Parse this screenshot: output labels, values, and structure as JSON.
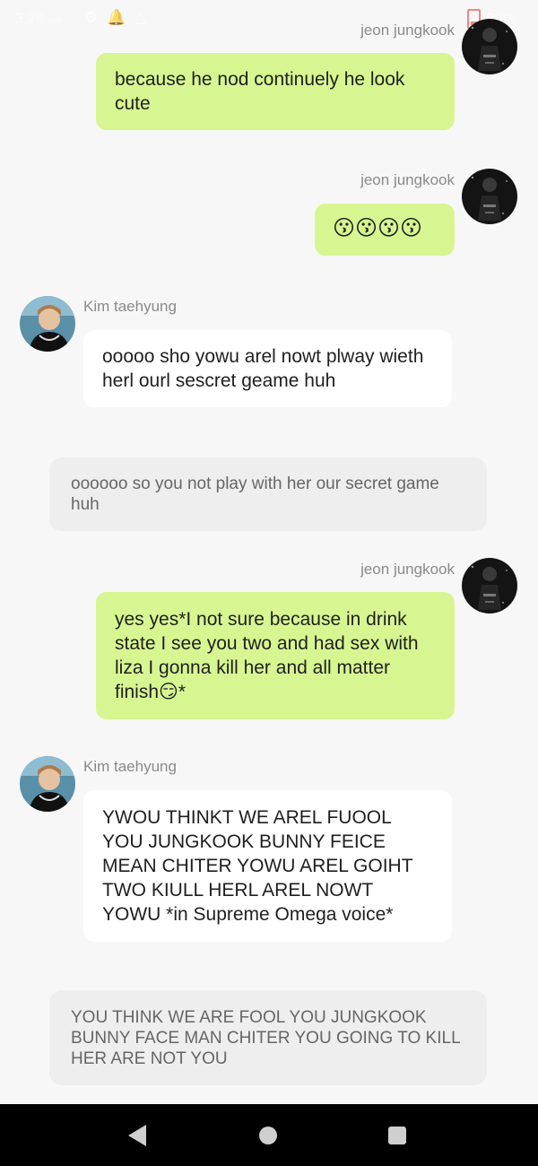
{
  "status_bar": {
    "time": "3:28",
    "ampm": "am",
    "icons": [
      "gear-icon",
      "notification-bell-icon",
      "warning-triangle-icon"
    ],
    "battery": "28%",
    "battery_color": "#e55555"
  },
  "colors": {
    "my_bubble": "#d7f692",
    "their_bubble": "#ffffff",
    "narration_bubble": "#eeeeee",
    "background": "#f7f7f7"
  },
  "messages": [
    {
      "sender": "jeon jungkook",
      "text": "because he nod continuely he look cute"
    },
    {
      "sender": "jeon jungkook",
      "text": "😗😗😗😗"
    },
    {
      "sender": "Kim taehyung",
      "text": "ooooo sho yowu arel nowt plway wieth herl ourl sescret geame huh"
    },
    {
      "narration": "oooooo so you not play with her our secret game huh"
    },
    {
      "sender": "jeon jungkook",
      "text": "yes yes*I not sure because in drink state I see you two and had sex with liza I gonna kill her and all matter finish😏*"
    },
    {
      "sender": "Kim taehyung",
      "text": "YWOU THINKT WE AREL FUOOL YOU JUNGKOOK BUNNY FEICE MEAN CHITER YOWU AREL GOIHT TWO KIULL HERL AREL NOWT YOWU *in Supreme Omega voice*"
    },
    {
      "narration": "YOU THINK WE ARE FOOL YOU JUNGKOOK BUNNY FACE MAN CHITER  YOU GOING TO KILL HER ARE NOT YOU"
    }
  ],
  "nav_bar": {
    "buttons": [
      "back-icon",
      "home-icon",
      "recents-icon"
    ]
  }
}
